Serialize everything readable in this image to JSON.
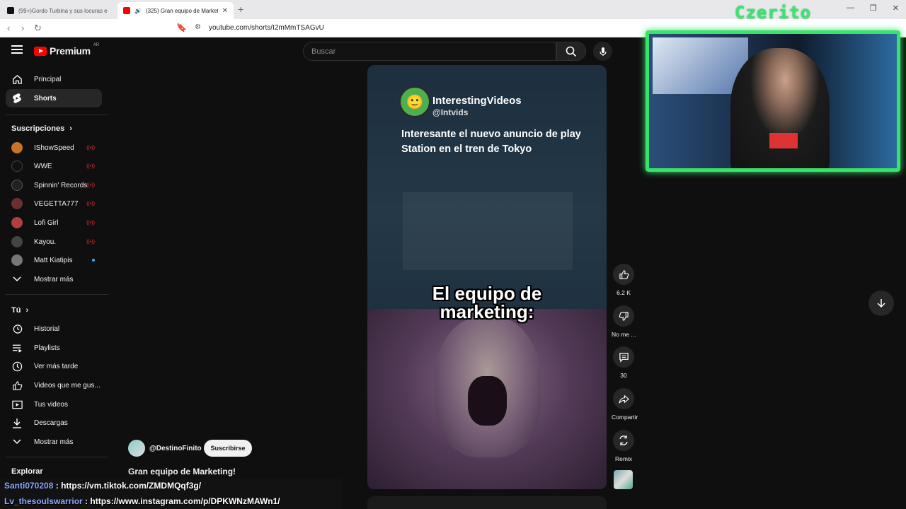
{
  "browser": {
    "tabs": [
      {
        "title": "(99+)Gordo Turbina y sus locuras en",
        "active": false
      },
      {
        "title": "(325) Gran equipo de Marketi",
        "active": true
      }
    ],
    "new_tab": "+",
    "url": "youtube.com/shorts/I2mMmTSAGvU"
  },
  "header": {
    "brand": "Premium",
    "country": "AR",
    "search_placeholder": "Buscar"
  },
  "sidebar": {
    "top_items": [
      {
        "label": "Principal",
        "icon": "home-icon"
      },
      {
        "label": "Shorts",
        "icon": "shorts-icon",
        "active": true
      }
    ],
    "subscriptions_header": "Suscripciones",
    "subscriptions": [
      {
        "label": "IShowSpeed",
        "status": "live",
        "color": "#c8742a"
      },
      {
        "label": "WWE",
        "status": "live",
        "color": "#111111"
      },
      {
        "label": "Spinnin' Records",
        "status": "live",
        "color": "#222222"
      },
      {
        "label": "VEGETTA777",
        "status": "live",
        "color": "#6a3030"
      },
      {
        "label": "Lofi Girl",
        "status": "live",
        "color": "#b04040"
      },
      {
        "label": "Kayou.",
        "status": "live",
        "color": "#444444"
      },
      {
        "label": "Matt Kiatipis",
        "status": "new",
        "color": "#777777"
      }
    ],
    "subs_more": "Mostrar más",
    "you_header": "Tú",
    "you_items": [
      {
        "label": "Historial",
        "icon": "history-icon"
      },
      {
        "label": "Playlists",
        "icon": "playlist-icon"
      },
      {
        "label": "Ver más tarde",
        "icon": "clock-icon"
      },
      {
        "label": "Videos que me gus...",
        "icon": "thumbs-up-icon"
      },
      {
        "label": "Tus videos",
        "icon": "video-icon"
      },
      {
        "label": "Descargas",
        "icon": "download-icon"
      }
    ],
    "you_more": "Mostrar más",
    "explore_header": "Explorar"
  },
  "video": {
    "channel_name": "InterestingVideos",
    "channel_handle": "@Intvids",
    "caption": "Interesante el nuevo anuncio de play Station en el tren de Tokyo",
    "meme_line1": "El equipo de",
    "meme_line2": "marketing:"
  },
  "actions": {
    "likes": "6.2 K",
    "dislike": "No me ...",
    "comments": "30",
    "share": "Compartir",
    "remix": "Remix"
  },
  "short_info": {
    "channel": "@DestinoFinito",
    "subscribe": "Suscribirse",
    "title": "Gran equipo de Marketing!"
  },
  "stream": {
    "streamer": "Czerito",
    "accent": "#39e26a"
  },
  "chat": [
    {
      "user": "Santi070208",
      "message": ": https://vm.tiktok.com/ZMDMQqf3g/"
    },
    {
      "user": "Lv_thesoulswarrior",
      "message": ": https://www.instagram.com/p/DPKWNzMAWn1/"
    }
  ]
}
